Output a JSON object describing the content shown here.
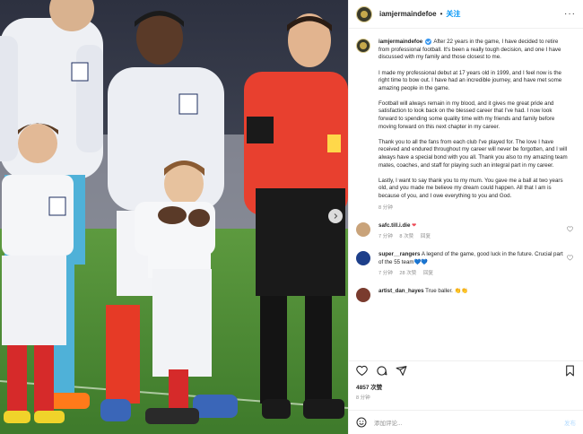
{
  "post": {
    "username": "iamjermaindefoe",
    "dot": "•",
    "follow_label": "关注",
    "more_label": "···",
    "caption": {
      "username": "iamjermaindefoe",
      "paragraphs": [
        "After 22 years in the game, I have decided to retire from professional football. It's been a really tough decision, and one I have discussed with my family and those closest to me.",
        "I made my professional debut at 17 years old in 1999, and I feel now is the right time to bow out. I have had an incredible journey, and have met some amazing people in the game.",
        "Football will always remain in my blood, and it gives me great pride and satisfaction to look back on the blessed career that I've had. I now look forward to spending some quality time with my friends and family before moving forward on this next chapter in my career.",
        "Thank you to all the fans from each club I've played for. The love I have received and endured throughout my career will never be forgotten, and I will always have a special bond with you all. Thank you also to my amazing team mates, coaches, and staff for playing such an integral part in my career.",
        "Lastly, I want to say thank you to my mum. You gave me a ball at two years old, and you made me believe my dream could happen. All that I am is because of you, and I owe everything to you and God."
      ],
      "time": "8 分钟"
    },
    "comments": [
      {
        "username": "safc.till.i.die",
        "text": "❤",
        "time": "7 分钟",
        "likes": "8 次赞",
        "reply": "回复",
        "avatar_color": "#c9a37a"
      },
      {
        "username": "super__rangers",
        "text": "A legend of the game, good luck in the future. Crucial part of the 55 team💙💙",
        "time": "7 分钟",
        "likes": "28 次赞",
        "reply": "回复",
        "avatar_color": "#1d3f8a"
      },
      {
        "username": "artist_dan_hayes",
        "text": "True baller. 👏👏",
        "avatar_color": "#7a3b2e"
      }
    ],
    "likes_label": "4857 次赞",
    "age_label": "8 分钟",
    "add_comment_placeholder": "添加评论...",
    "post_button": "发布"
  },
  "colors": {
    "link_blue": "#0095f6",
    "heart_red": "#ed4956",
    "referee_red": "#e8402f",
    "pitch_green": "#3f7a2e"
  },
  "icons": {
    "like": "heart-outline-icon",
    "comment": "speech-bubble-icon",
    "share": "paper-plane-icon",
    "save": "bookmark-icon",
    "next": "chevron-right-icon",
    "emoji": "smiley-icon"
  }
}
